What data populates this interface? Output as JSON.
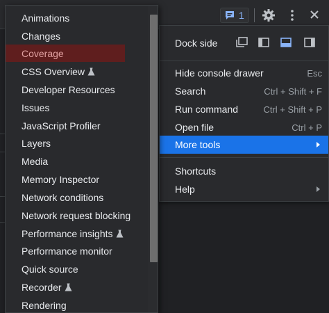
{
  "toolbar": {
    "issues_count": "1",
    "icons": [
      "issues-icon",
      "gear-icon",
      "kebab-menu-icon",
      "close-icon"
    ]
  },
  "main_menu": {
    "dock_side_label": "Dock side",
    "dock_options": [
      "undock-icon",
      "dock-left-icon",
      "dock-bottom-icon",
      "dock-right-icon"
    ],
    "dock_selected": "dock-bottom-icon",
    "items": [
      {
        "label": "Hide console drawer",
        "shortcut": "Esc"
      },
      {
        "label": "Search",
        "shortcut": "Ctrl + Shift + F"
      },
      {
        "label": "Run command",
        "shortcut": "Ctrl + Shift + P"
      },
      {
        "label": "Open file",
        "shortcut": "Ctrl + P"
      },
      {
        "label": "More tools",
        "shortcut": ""
      }
    ],
    "items2": [
      {
        "label": "Shortcuts"
      },
      {
        "label": "Help"
      }
    ]
  },
  "more_tools_menu": {
    "items": [
      {
        "label": "Animations"
      },
      {
        "label": "Changes"
      },
      {
        "label": "Coverage"
      },
      {
        "label": "CSS Overview"
      },
      {
        "label": "Developer Resources"
      },
      {
        "label": "Issues"
      },
      {
        "label": "JavaScript Profiler"
      },
      {
        "label": "Layers"
      },
      {
        "label": "Media"
      },
      {
        "label": "Memory Inspector"
      },
      {
        "label": "Network conditions"
      },
      {
        "label": "Network request blocking"
      },
      {
        "label": "Performance insights"
      },
      {
        "label": "Performance monitor"
      },
      {
        "label": "Quick source"
      },
      {
        "label": "Recorder"
      },
      {
        "label": "Rendering"
      }
    ]
  },
  "colors": {
    "menu_bg": "#292a2d",
    "highlight": "#1a73e8",
    "selected_item_bg": "#5f1e1e",
    "text": "#e8eaed",
    "shortcut_text": "#9aa0a6",
    "badge_blue": "#8ab4f8"
  }
}
